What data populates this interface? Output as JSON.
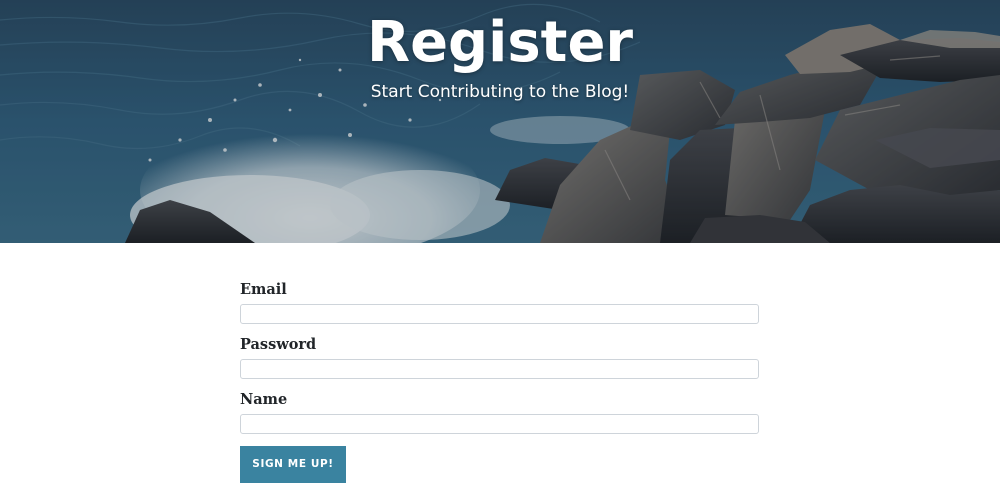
{
  "hero": {
    "title": "Register",
    "subtitle": "Start Contributing to the Blog!",
    "image_subject": "ocean waves splashing on rocks"
  },
  "form": {
    "fields": [
      {
        "label": "Email",
        "value": "",
        "placeholder": ""
      },
      {
        "label": "Password",
        "value": "",
        "placeholder": ""
      },
      {
        "label": "Name",
        "value": "",
        "placeholder": ""
      }
    ],
    "submit_label": "SIGN ME UP!"
  },
  "colors": {
    "accent": "#3a83a0",
    "ocean": "#2f5874",
    "rock": "#3d3d40",
    "text": "#212529"
  }
}
